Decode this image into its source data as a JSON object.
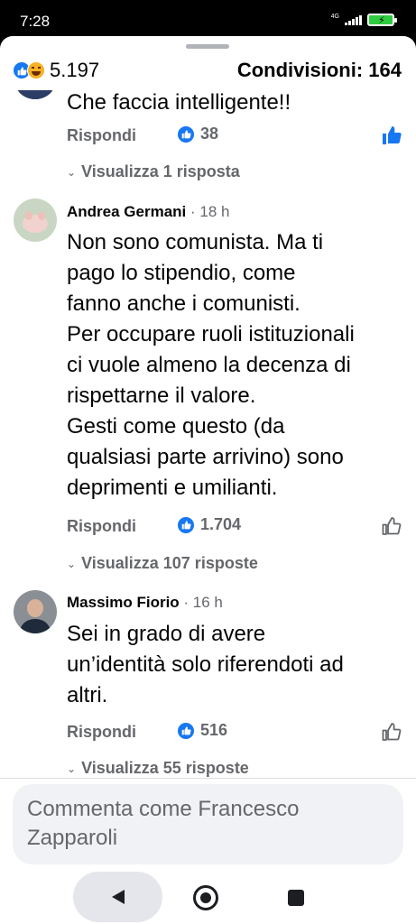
{
  "status_bar": {
    "time": "7:28",
    "network": "4G"
  },
  "header": {
    "reaction_count": "5.197",
    "shares_label": "Condivisioni: 164"
  },
  "comments": [
    {
      "text": "Che faccia intelligente!!",
      "reply_label": "Rispondi",
      "likes": "38",
      "view_replies": "Visualizza 1 risposta"
    },
    {
      "author": "Andrea Germani",
      "time": " · 18 h",
      "text": "Non sono comunista. Ma ti pago lo stipendio, come fanno anche i comunisti.\nPer occupare ruoli istituzionali ci vuole almeno la decenza di rispettarne il valore.\nGesti come questo (da qualsiasi parte arrivino) sono deprimenti e umilianti.",
      "reply_label": "Rispondi",
      "likes": "1.704",
      "view_replies": "Visualizza 107 risposte"
    },
    {
      "author": "Massimo Fiorio",
      "time": " · 16 h",
      "text": "Sei in grado di avere un’identità solo riferendoti ad altri.",
      "reply_label": "Rispondi",
      "likes": "516",
      "view_replies": "Visualizza 55 risposte"
    }
  ],
  "composer": {
    "placeholder": "Commenta come Francesco Zapparoli"
  },
  "colors": {
    "accent": "#1877f2",
    "secondary_text": "#65676b",
    "primary_text": "#050505"
  }
}
